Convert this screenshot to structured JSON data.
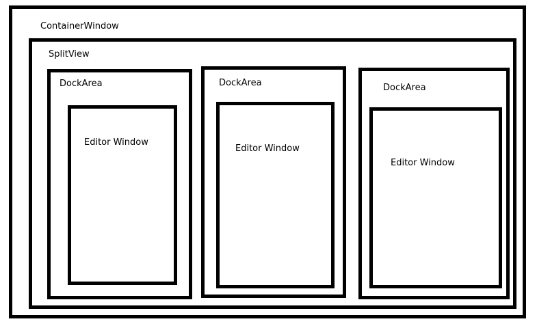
{
  "container": {
    "label": "ContainerWindow"
  },
  "split_view": {
    "label": "SplitView"
  },
  "dock_areas": [
    {
      "label": "DockArea",
      "editor": {
        "label": "Editor Window"
      }
    },
    {
      "label": "DockArea",
      "editor": {
        "label": "Editor Window"
      }
    },
    {
      "label": "DockArea",
      "editor": {
        "label": "Editor Window"
      }
    }
  ]
}
